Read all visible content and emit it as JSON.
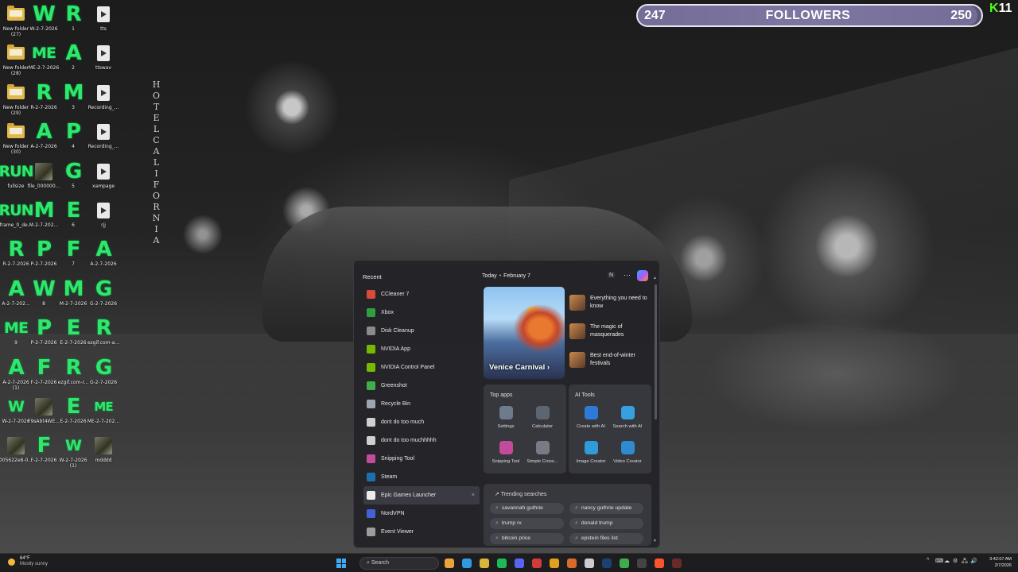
{
  "desktop": {
    "icons": [
      {
        "type": "folder",
        "label": "New folder\n(27)"
      },
      {
        "type": "text",
        "text": "W",
        "label": "W-2-7-2026"
      },
      {
        "type": "text",
        "text": "R",
        "label": "1"
      },
      {
        "type": "file",
        "label": "tts"
      },
      {
        "type": "folder",
        "label": "New folder\n(28)"
      },
      {
        "type": "text",
        "text": "ME",
        "label": "ME-2-7-2026",
        "size": "sm"
      },
      {
        "type": "text",
        "text": "A",
        "label": "2"
      },
      {
        "type": "file",
        "label": "ttswav"
      },
      {
        "type": "folder",
        "label": "New folder\n(29)"
      },
      {
        "type": "text",
        "text": "R",
        "label": "R-2-7-2026"
      },
      {
        "type": "text",
        "text": "M",
        "label": "3"
      },
      {
        "type": "file",
        "label": "Recording_..."
      },
      {
        "type": "folder",
        "label": "New folder\n(30)"
      },
      {
        "type": "text",
        "text": "A",
        "label": "A-2-7-2026"
      },
      {
        "type": "text",
        "text": "P",
        "label": "4"
      },
      {
        "type": "file",
        "label": "Recording_..."
      },
      {
        "type": "text",
        "text": "RUN",
        "label": "fullsize",
        "size": "sm"
      },
      {
        "type": "thumb",
        "label": "file_000000..."
      },
      {
        "type": "text",
        "text": "G",
        "label": "5"
      },
      {
        "type": "file",
        "label": "xampage"
      },
      {
        "type": "text",
        "text": "RUN",
        "label": "frame_0_de...",
        "size": "sm"
      },
      {
        "type": "text",
        "text": "M",
        "label": "M-2-7-202..."
      },
      {
        "type": "text",
        "text": "E",
        "label": "6"
      },
      {
        "type": "file",
        "label": "rjj"
      },
      {
        "type": "text",
        "text": "R",
        "label": "R-2-7-2026"
      },
      {
        "type": "text",
        "text": "P",
        "label": "P-2-7-2026"
      },
      {
        "type": "text",
        "text": "F",
        "label": "7"
      },
      {
        "type": "text",
        "text": "A",
        "label": "A-2-7-2026"
      },
      {
        "type": "text",
        "text": "A",
        "label": "A-2-7-202..."
      },
      {
        "type": "text",
        "text": "W",
        "label": "8"
      },
      {
        "type": "text",
        "text": "M",
        "label": "M-2-7-2026"
      },
      {
        "type": "text",
        "text": "G",
        "label": "G-2-7-2026"
      },
      {
        "type": "text",
        "text": "ME",
        "label": "9",
        "size": "sm"
      },
      {
        "type": "text",
        "text": "P",
        "label": "P-2-7-2026"
      },
      {
        "type": "text",
        "text": "E",
        "label": "E-2-7-2026"
      },
      {
        "type": "text",
        "text": "R",
        "label": "ezgif.com-a..."
      },
      {
        "type": "text",
        "text": "A",
        "label": "A-2-7-2026\n(1)"
      },
      {
        "type": "text",
        "text": "F",
        "label": "F-2-7-2026"
      },
      {
        "type": "text",
        "text": "R",
        "label": "ezgif.com-r..."
      },
      {
        "type": "text",
        "text": "G",
        "label": "G-2-7-2026"
      },
      {
        "type": "text",
        "text": "W",
        "label": "W-2-7-2026",
        "size": "sm"
      },
      {
        "type": "thumb",
        "label": "F9sAbt4WE..."
      },
      {
        "type": "text",
        "text": "E",
        "label": "E-2-7-2026"
      },
      {
        "type": "text",
        "text": "ME",
        "label": "ME-2-7-202...",
        "size": "xs"
      },
      {
        "type": "thumb",
        "label": "005622e8-0..."
      },
      {
        "type": "text",
        "text": "F",
        "label": "F-2-7-2026"
      },
      {
        "type": "text",
        "text": "W",
        "label": "W-2-7-2026\n(1)",
        "size": "sm"
      },
      {
        "type": "thumb",
        "label": "mdddd"
      }
    ],
    "hotel_sign": [
      "H",
      "O",
      "T",
      "E",
      "L",
      "",
      "C",
      "A",
      "L",
      "I",
      "F",
      "O",
      "R",
      "N",
      "I",
      "A"
    ]
  },
  "followers_bar": {
    "current": "247",
    "label": "FOLLOWERS",
    "goal": "250",
    "progress_fraction": 0.988
  },
  "kick_badge": {
    "logo": "K",
    "count": "11"
  },
  "start_menu": {
    "recent_title": "Recent",
    "recent": [
      {
        "label": "CCleaner 7",
        "color": "#d84a3a"
      },
      {
        "label": "Xbox",
        "color": "#2f9e3f"
      },
      {
        "label": "Disk Cleanup",
        "color": "#8a8a8a"
      },
      {
        "label": "NVIDIA App",
        "color": "#76b900"
      },
      {
        "label": "NVIDIA Control Panel",
        "color": "#76b900"
      },
      {
        "label": "Greenshot",
        "color": "#3fae4a"
      },
      {
        "label": "Recycle Bin",
        "color": "#9aa7b3"
      },
      {
        "label": "dont do too much",
        "color": "#cfcfcf"
      },
      {
        "label": "dont do too muchhhhh",
        "color": "#cfcfcf"
      },
      {
        "label": "Snipping Tool",
        "color": "#c24b9b"
      },
      {
        "label": "Steam",
        "color": "#1b6fae"
      },
      {
        "label": "Epic Games Launcher",
        "color": "#ececec",
        "highlight": true,
        "close": "×"
      },
      {
        "label": "NordVPN",
        "color": "#4263d8"
      },
      {
        "label": "Event Viewer",
        "color": "#9c9c9c"
      }
    ],
    "today": {
      "label": "Today",
      "date": "February 7"
    },
    "header_n": "N",
    "header_more": "···",
    "hero_caption": "Venice Carnival ›",
    "stories": [
      {
        "text": "Everything you need to know"
      },
      {
        "text": "The magic of masquerades"
      },
      {
        "text": "Best end-of-winter festivals"
      }
    ],
    "top_apps": {
      "title": "Top apps",
      "items": [
        {
          "label": "Settings",
          "color": "#6d7b8c"
        },
        {
          "label": "Calculator",
          "color": "#5d6570"
        },
        {
          "label": "Snipping Tool",
          "color": "#c24b9b"
        },
        {
          "label": "Simple Cross...",
          "color": "#7a7a86"
        }
      ]
    },
    "ai_tools": {
      "title": "AI Tools",
      "items": [
        {
          "label": "Create with AI",
          "color": "#2f7ad8"
        },
        {
          "label": "Search with AI",
          "color": "#37a0e0"
        },
        {
          "label": "Image Creator",
          "color": "#2f9bd8"
        },
        {
          "label": "Video Creator",
          "color": "#2f8ad0"
        }
      ]
    },
    "trending": {
      "title": "Trending searches",
      "items": [
        "savannah guthrie",
        "nancy guthrie update",
        "trump rx",
        "donald trump",
        "bitcoin price",
        "epstein files list"
      ]
    }
  },
  "taskbar": {
    "weather_temp": "64°F",
    "weather_desc": "Mostly sunny",
    "search_placeholder": "Search",
    "apps": [
      {
        "name": "chrome",
        "color": "#e8a33a"
      },
      {
        "name": "edge",
        "color": "#2f9be0"
      },
      {
        "name": "explorer",
        "color": "#d9b43a"
      },
      {
        "name": "spotify",
        "color": "#1db954"
      },
      {
        "name": "discord",
        "color": "#5865f2"
      },
      {
        "name": "opera",
        "color": "#d33a3a"
      },
      {
        "name": "shield",
        "color": "#e0a020"
      },
      {
        "name": "app-orange",
        "color": "#d86a2a"
      },
      {
        "name": "github",
        "color": "#cccccc"
      },
      {
        "name": "photoshop",
        "color": "#1d3f72"
      },
      {
        "name": "greenshot",
        "color": "#3fae4a"
      },
      {
        "name": "terminal",
        "color": "#444444"
      },
      {
        "name": "brave",
        "color": "#fb542b"
      },
      {
        "name": "obs",
        "color": "#6a2a2a"
      }
    ],
    "tray": [
      "^",
      "⌨",
      "☁",
      "⚙",
      "🖧",
      "🔊"
    ],
    "time": "3:42:07 AM",
    "date": "2/7/2026"
  }
}
